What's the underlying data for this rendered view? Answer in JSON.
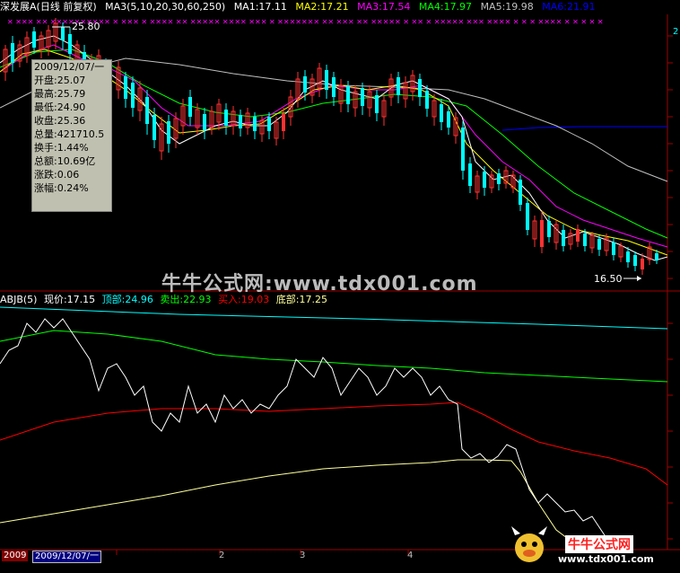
{
  "header": {
    "stock_name": "深发展A",
    "period": "(日线 前复权)",
    "ma_params": "MA3(5,10,20,30,60,250)",
    "ma1": "MA1:17.11",
    "ma2": "MA2:17.21",
    "ma3": "MA3:17.54",
    "ma4": "MA4:17.97",
    "ma5": "MA5:19.98",
    "ma6": "MA6:21.91",
    "right_marker": "2"
  },
  "price_labels": {
    "high_label": "25.80",
    "low_label": "16.50"
  },
  "tooltip": {
    "date": "2009/12/07/一",
    "open": "开盘:25.07",
    "high": "最高:25.79",
    "low": "最低:24.90",
    "close": "收盘:25.36",
    "volume": "总量:421710.5",
    "turnover": "换手:1.44%",
    "amount": "总额:10.69亿",
    "change": "涨跌:0.06",
    "change_pct": "涨幅:0.24%"
  },
  "indicator": {
    "name": "ABJB(5)",
    "price": "现价:17.15",
    "top": "顶部:24.96",
    "sell": "卖出:22.93",
    "buy": "买入:19.03",
    "bottom": "底部:17.25"
  },
  "watermark": "牛牛公式网:www.tdx001.com",
  "bottom_bar": {
    "year": "2009",
    "date": "2009/12/07/一",
    "month_2": "2",
    "month_3": "3",
    "month_4": "4"
  },
  "logo": {
    "title": "牛牛公式网",
    "url": "www.tdx001.com"
  },
  "colors": {
    "ma1": "#ffffff",
    "ma2": "#ffff00",
    "ma3": "#ff00ff",
    "ma4": "#00ff00",
    "ma5": "#c0c0c0",
    "ma6": "#0000ff",
    "up": "#ff3232",
    "down": "#00ffff",
    "top_line": "#00ffff",
    "sell_line": "#00ff00",
    "buy_line": "#ff0000",
    "bottom_line": "#ffff99"
  }
}
